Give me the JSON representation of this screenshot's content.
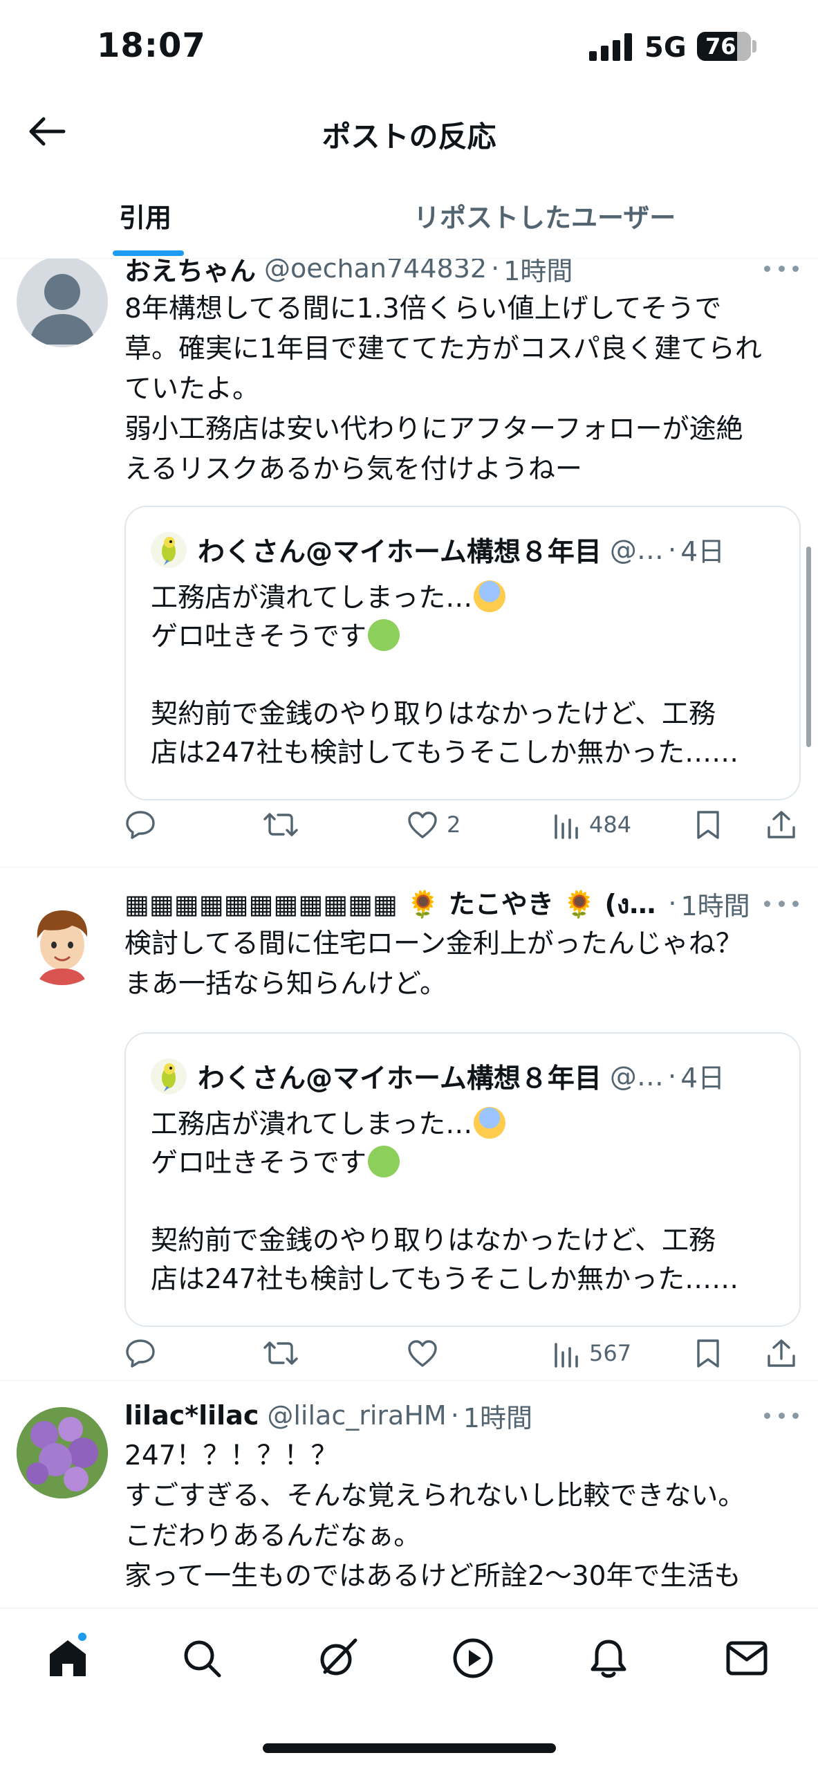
{
  "status_bar": {
    "time": "18:07",
    "network": "5G",
    "battery": "76"
  },
  "header": {
    "title": "ポストの反応"
  },
  "tabs": [
    {
      "label": "引用",
      "active": true
    },
    {
      "label": "リポストしたユーザー",
      "active": false
    }
  ],
  "posts": [
    {
      "display_name": "おえちゃん",
      "handle": "@oechan744832",
      "time": "1時間",
      "text_lines": [
        "8年構想してる間に1.3倍くらい値上げしてそうで",
        "草。確実に1年目で建ててた方がコスパ良く建てられ",
        "ていたよ。",
        "弱小工務店は安い代わりにアフターフォローが途絶",
        "えるリスクあるから気を付けようねー"
      ],
      "quote": {
        "name": "わくさん@マイホーム構想８年目",
        "handle": "@…",
        "time": "4日",
        "lines": [
          "工務店が潰れてしまった…",
          "ゲロ吐きそうです",
          "",
          "契約前で金銭のやり取りはなかったけど、工務",
          "店は247社も検討してもうそこしか無かった……"
        ]
      },
      "actions": {
        "replies": "",
        "reposts": "",
        "likes": "2",
        "views": "484"
      }
    },
    {
      "display_name": "▦▦▦▦▦▦▦▦▦▦▦ 🌻 たこやき 🌻 (ง…",
      "handle": "",
      "time": "1時間",
      "text_lines": [
        "検討してる間に住宅ローン金利上がったんじゃね？",
        "まあ一括なら知らんけど。"
      ],
      "quote": {
        "name": "わくさん@マイホーム構想８年目",
        "handle": "@…",
        "time": "4日",
        "lines": [
          "工務店が潰れてしまった…",
          "ゲロ吐きそうです",
          "",
          "契約前で金銭のやり取りはなかったけど、工務",
          "店は247社も検討してもうそこしか無かった……"
        ]
      },
      "actions": {
        "replies": "",
        "reposts": "",
        "likes": "",
        "views": "567"
      }
    },
    {
      "display_name": "lilac*lilac",
      "handle": "@lilac_riraHM",
      "time": "1時間",
      "text_lines": [
        "247！？！？！？",
        "すごすぎる、そんな覚えられないし比較できない。",
        "こだわりあるんだなぁ。",
        "家って一生ものではあるけど所詮2〜30年で生活も"
      ]
    }
  ],
  "icons": {
    "back": "back-arrow-icon",
    "more": "more-dots-icon",
    "reply": "reply-icon",
    "repost": "repost-icon",
    "like": "heart-icon",
    "views": "views-chart-icon",
    "bookmark": "bookmark-icon",
    "share": "share-icon",
    "nav": [
      "home-icon",
      "search-icon",
      "grok-icon",
      "video-icon",
      "notifications-icon",
      "messages-icon"
    ]
  },
  "colors": {
    "accent": "#1d9bf0",
    "secondary_text": "#536471",
    "text": "#0f1419"
  }
}
